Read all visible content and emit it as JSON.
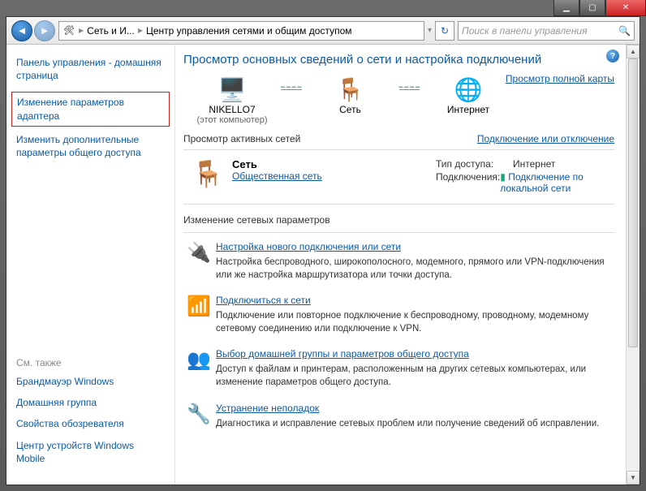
{
  "titlebar": {
    "min": "▁",
    "max": "▢",
    "close": "✕"
  },
  "addressbar": {
    "seg1": "Сеть и И...",
    "seg2": "Центр управления сетями и общим доступом"
  },
  "search": {
    "placeholder": "Поиск в панели управления"
  },
  "sidebar": {
    "home": "Панель управления - домашняя страница",
    "adapter": "Изменение параметров адаптера",
    "advanced": "Изменить дополнительные параметры общего доступа",
    "seealso_label": "См. также",
    "firewall": "Брандмауэр Windows",
    "homegroup": "Домашняя группа",
    "browser": "Свойства обозревателя",
    "wmdc": "Центр устройств Windows Mobile"
  },
  "main": {
    "heading": "Просмотр основных сведений о сети и настройка подключений",
    "fullmap": "Просмотр полной карты",
    "node_pc": "NIKELLO7",
    "node_pc_sub": "(этот компьютер)",
    "node_net": "Сеть",
    "node_internet": "Интернет",
    "active_label": "Просмотр активных сетей",
    "connect_disconnect": "Подключение или отключение",
    "net_name": "Сеть",
    "net_type": "Общественная сеть",
    "access_label": "Тип доступа:",
    "access_value": "Интернет",
    "conn_label": "Подключения:",
    "conn_value": "Подключение по локальной сети",
    "change_hdr": "Изменение сетевых параметров",
    "tasks": [
      {
        "title": "Настройка нового подключения или сети",
        "desc": "Настройка беспроводного, широкополосного, модемного, прямого или VPN-подключения или же настройка маршрутизатора или точки доступа."
      },
      {
        "title": "Подключиться к сети",
        "desc": "Подключение или повторное подключение к беспроводному, проводному, модемному сетевому соединению или подключение к VPN."
      },
      {
        "title": "Выбор домашней группы и параметров общего доступа",
        "desc": "Доступ к файлам и принтерам, расположенным на других сетевых компьютерах, или изменение параметров общего доступа."
      },
      {
        "title": "Устранение неполадок",
        "desc": "Диагностика и исправление сетевых проблем или получение сведений об исправлении."
      }
    ]
  }
}
